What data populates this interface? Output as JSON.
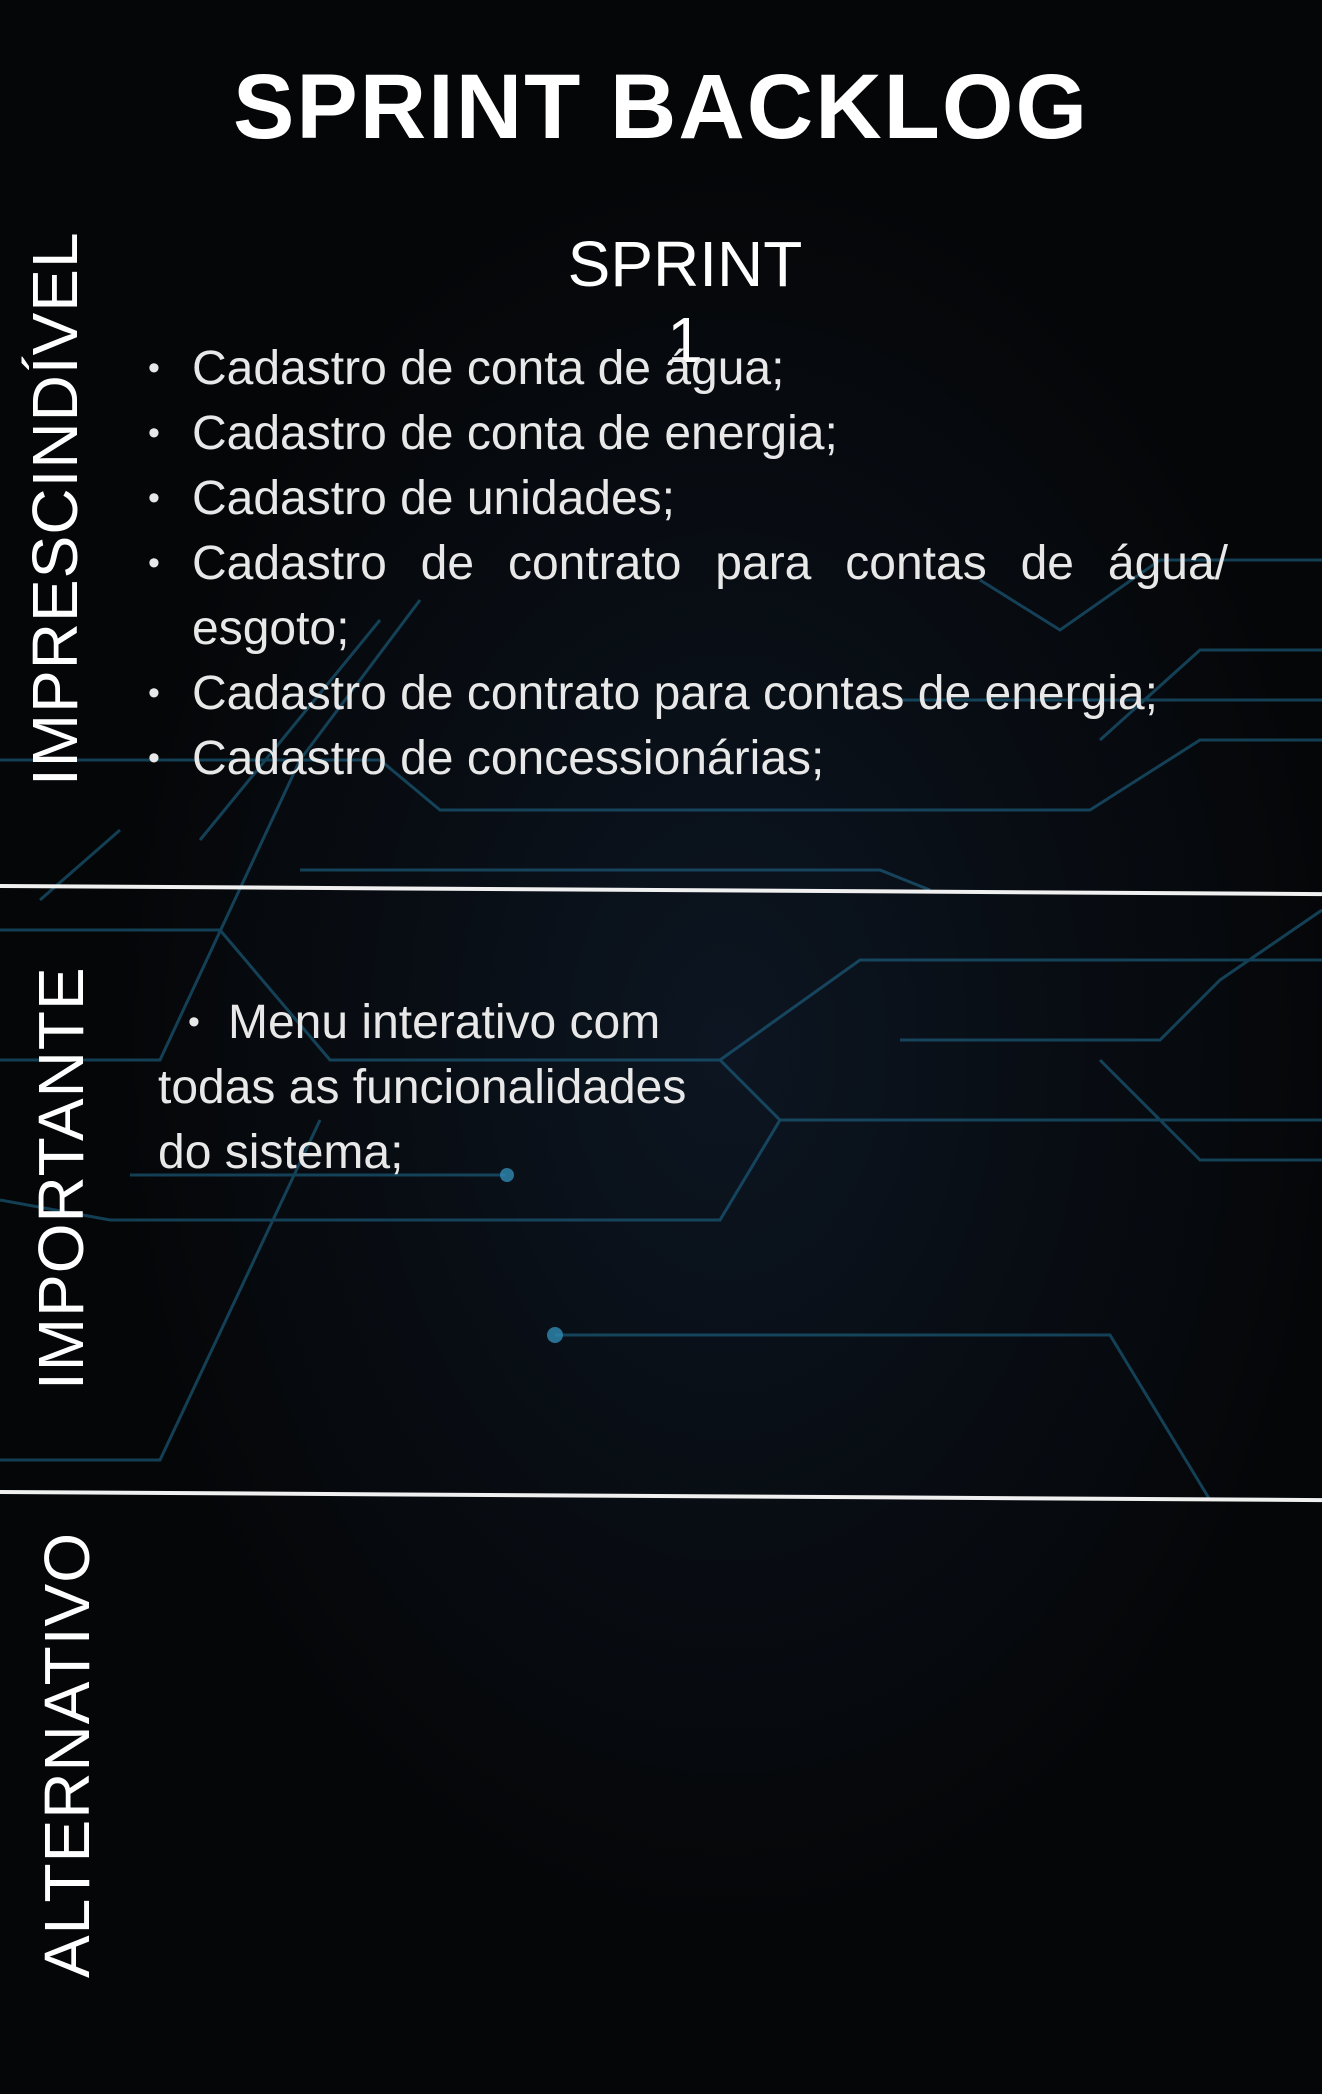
{
  "title": "SPRINT BACKLOG",
  "sprint": "SPRINT 1",
  "sections": {
    "imprescindivel": {
      "label": "IMPRESCINDÍVEL",
      "items": [
        "Cadastro de conta de água;",
        "Cadastro de conta de energia;",
        "Cadastro de unidades;",
        "Cadastro de contrato para contas de água/ esgoto;",
        "Cadastro de contrato para contas de energia;",
        "Cadastro de concessionárias;"
      ]
    },
    "importante": {
      "label": "IMPORTANTE",
      "bullet": "•",
      "item": "Menu interativo com todas as funcionalidades do sistema;"
    },
    "alternativo": {
      "label": "ALTERNATIVO"
    }
  },
  "colors": {
    "background": "#050608",
    "circuit": "#1f6f93",
    "text": "#ffffff"
  }
}
